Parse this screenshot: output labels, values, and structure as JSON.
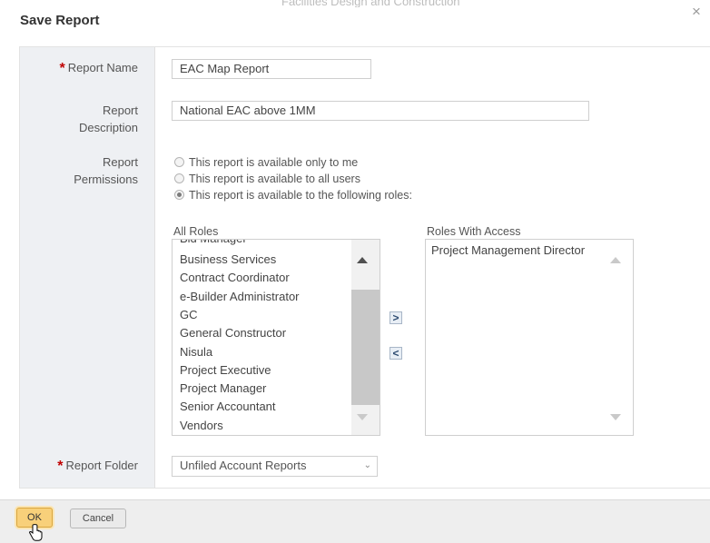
{
  "background": {
    "page_title": "Facilities Design and Construction"
  },
  "dialog": {
    "title": "Save Report",
    "close_symbol": "×"
  },
  "form": {
    "report_name": {
      "label": "Report Name",
      "required": true,
      "value": "EAC Map Report"
    },
    "report_description": {
      "label_line1": "Report",
      "label_line2": "Description",
      "value": "National EAC above 1MM"
    },
    "report_permissions": {
      "label_line1": "Report",
      "label_line2": "Permissions",
      "options": [
        {
          "label": "This report is available only to me",
          "selected": false
        },
        {
          "label": "This report is available to all users",
          "selected": false
        },
        {
          "label": "This report is available to the following roles:",
          "selected": true
        }
      ]
    },
    "all_roles": {
      "title": "All Roles",
      "items": [
        "Bid Manager",
        "Business Services",
        "Contract Coordinator",
        "e-Builder Administrator",
        "GC",
        "General Constructor",
        "Nisula",
        "Project Executive",
        "Project Manager",
        "Senior Accountant",
        "Vendors"
      ]
    },
    "move_right_symbol": ">",
    "move_left_symbol": "<",
    "roles_with_access": {
      "title": "Roles With Access",
      "items": [
        "Project Management Director"
      ]
    },
    "report_folder": {
      "label": "Report Folder",
      "required": true,
      "value": "Unfiled Account Reports",
      "caret": "⌄"
    }
  },
  "footer": {
    "ok_label": "OK",
    "cancel_label": "Cancel"
  },
  "colors": {
    "required": "#c00000",
    "ok_button": "#f8d07a",
    "label_column": "#eef0f3"
  },
  "icons": {
    "close": "close-icon",
    "move_right": "chevron-right-icon",
    "move_left": "chevron-left-icon",
    "cursor": "hand-pointer-icon"
  }
}
